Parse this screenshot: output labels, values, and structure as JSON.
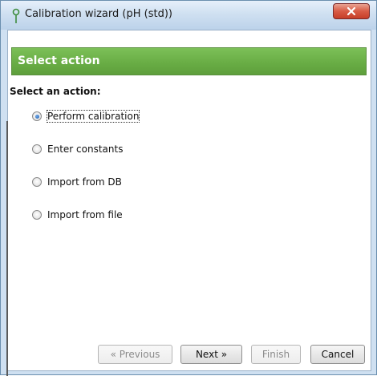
{
  "window": {
    "title": "Calibration wizard (pH (std))"
  },
  "header": {
    "title": "Select action"
  },
  "section_label": "Select an action:",
  "options": [
    {
      "label": "Perform calibration",
      "checked": true
    },
    {
      "label": "Enter constants",
      "checked": false
    },
    {
      "label": "Import from DB",
      "checked": false
    },
    {
      "label": "Import from file",
      "checked": false
    }
  ],
  "buttons": {
    "previous": "« Previous",
    "next": "Next »",
    "finish": "Finish",
    "cancel": "Cancel"
  },
  "colors": {
    "header_green": "#6aae46",
    "title_bar": "#cfe0f1",
    "close_red": "#d24b36"
  }
}
